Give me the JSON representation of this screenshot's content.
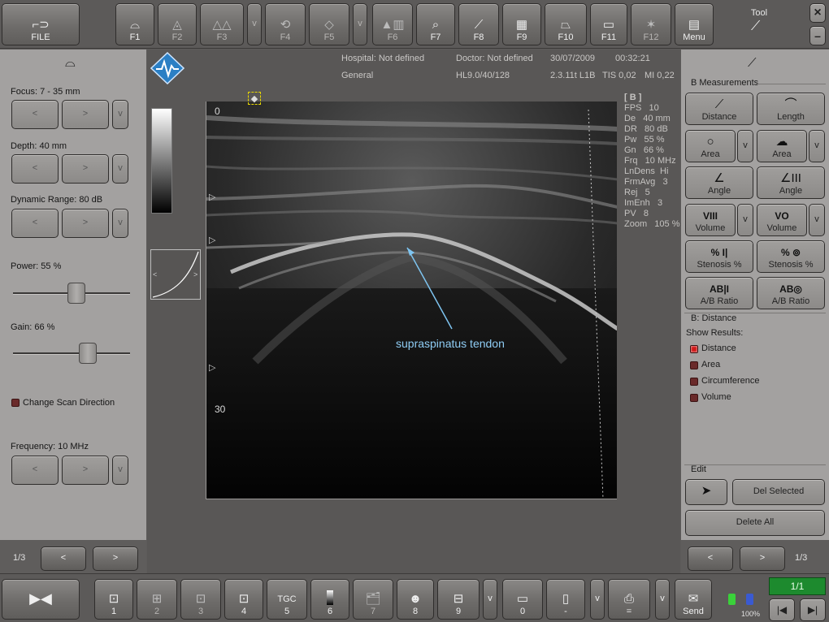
{
  "top_bar": {
    "file": "FILE",
    "f1": "F1",
    "f2": "F2",
    "f3": "F3",
    "more1": "v",
    "f4": "F4",
    "f5": "F5",
    "more2": "v",
    "f6": "F6",
    "f7": "F7",
    "f8": "F8",
    "f9": "F9",
    "f10": "F10",
    "f11": "F11",
    "f12": "F12",
    "menu": "Menu",
    "tool_label": "Tool",
    "close": "×",
    "minimize": "–"
  },
  "left_panel": {
    "focus": {
      "label": "Focus: 7 - 35 mm",
      "prev": "<",
      "next": ">",
      "more": "v"
    },
    "depth": {
      "label": "Depth: 40 mm",
      "prev": "<",
      "next": ">",
      "more": "v"
    },
    "dynamic_range": {
      "label": "Dynamic Range: 80 dB",
      "prev": "<",
      "next": ">",
      "more": "v"
    },
    "power": {
      "label": "Power: 55 %",
      "value": 55
    },
    "gain": {
      "label": "Gain: 66 %",
      "value": 66
    },
    "change_scan": {
      "label": "Change Scan Direction"
    },
    "frequency": {
      "label": "Frequency: 10 MHz",
      "prev": "<",
      "next": ">",
      "more": "v"
    },
    "page": "1/3",
    "page_prev": "<",
    "page_next": ">"
  },
  "header_info": {
    "hospital": "Hospital: Not defined",
    "doctor": "Doctor: Not defined",
    "date": "30/07/2009",
    "time": "00:32:21",
    "preset": "General",
    "probe": "HL9.0/40/128",
    "version": "2.3.11t L1B",
    "tis": "TIS 0,02",
    "mi": "MI 0,22"
  },
  "image": {
    "depth_top": "0",
    "depth_mark": "30",
    "annotation": "supraspinatus tendon"
  },
  "params": {
    "mode": "[ B ]",
    "lines": [
      "FPS   10",
      "De   40 mm",
      "DR   80 dB",
      "Pw   55 %",
      "Gn   66 %",
      "Frq   10 MHz",
      "LnDens  Hi",
      "FrmAvg   3",
      "Rej   5",
      "ImEnh   3",
      "PV   8",
      "Zoom   105 %"
    ]
  },
  "right_panel": {
    "section_b": "B Measurements",
    "distance": "Distance",
    "length": "Length",
    "area1": "Area",
    "area2": "Area",
    "angle1": "Angle",
    "angle2": "Angle",
    "volume1": "Volume",
    "volume2": "Volume",
    "stenosis1": "Stenosis %",
    "stenosis2": "Stenosis %",
    "ab1": "A/B Ratio",
    "ab2": "A/B Ratio",
    "more": "v",
    "stenosis_icon1": "% I|",
    "stenosis_icon2": "%",
    "ab_icon1": "AB|I",
    "ab_icon2": "AB◎",
    "volume_icon1": "VIII",
    "volume_icon2": "VO",
    "section_dist": "B: Distance",
    "show_results": "Show Results:",
    "results": [
      "Distance",
      "Area",
      "Circumference",
      "Volume"
    ],
    "section_edit": "Edit",
    "del_selected": "Del Selected",
    "delete_all": "Delete All",
    "page": "1/3",
    "page_prev": "<",
    "page_next": ">"
  },
  "bottom_bar": {
    "freeze": "",
    "b1": "1",
    "b2": "2",
    "b3": "3",
    "b4": "4",
    "tgc": "TGC",
    "b5": "5",
    "b6": "6",
    "b7": "7",
    "b8": "8",
    "b9": "9",
    "more1": "v",
    "b0": "0",
    "bdash": "-",
    "more2": "v",
    "beq": "=",
    "more3": "v",
    "send": "Send",
    "battery": "100%",
    "frame": "1/1"
  },
  "colors": {
    "accent_green": "#1d8a2e",
    "checkbox_red": "#d01a1a"
  }
}
